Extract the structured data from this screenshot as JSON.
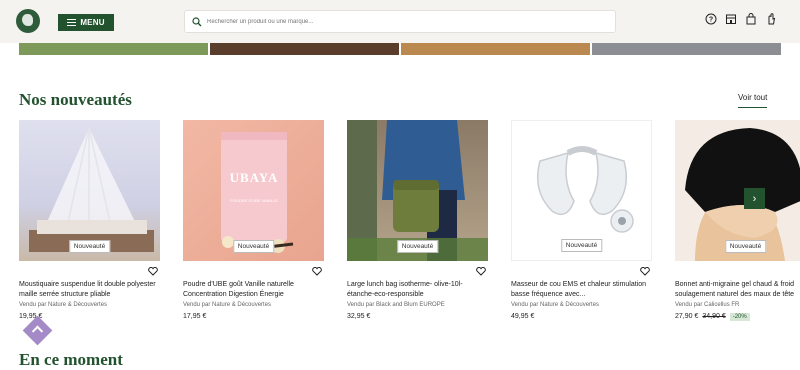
{
  "header": {
    "menu_label": "MENU",
    "search_placeholder": "Rechercher un produit ou une marque..."
  },
  "new_section": {
    "title": "Nos nouveautés",
    "see_all": "Voir tout"
  },
  "products": [
    {
      "title": "Moustiquaire suspendue lit double polyester maille serrée structure pliable",
      "seller": "Vendu par Nature & Découvertes",
      "price": "19,95 €",
      "badge": "Nouveauté"
    },
    {
      "title": "Poudre d'UBE goût Vanille naturelle Concentration Digestion Énergie",
      "seller": "Vendu par Nature & Découvertes",
      "price": "17,95 €",
      "badge": "Nouveauté",
      "image_text": "UBAYA",
      "image_subtext": "POUDRE D'UBE VANILLE"
    },
    {
      "title": "Large lunch bag isotherme- olive-10l-étanche-eco-responsible",
      "seller": "Vendu par Black and Blum EUROPE",
      "price": "32,95 €",
      "badge": "Nouveauté"
    },
    {
      "title": "Masseur de cou EMS et chaleur stimulation basse fréquence avec...",
      "seller": "Vendu par Nature & Découvertes",
      "price": "49,95 €",
      "badge": "Nouveauté"
    },
    {
      "title": "Bonnet anti-migraine gel chaud & froid soulagement naturel des maux de tête",
      "seller": "Vendu par Calicellus FR",
      "price": "27,90 €",
      "old_price": "34,90 €",
      "discount": "-20%",
      "badge": "Nouveauté"
    }
  ],
  "moment_section": {
    "title": "En ce moment"
  },
  "colors": {
    "brand_green": "#23522f",
    "accent_purple": "#a48ac6"
  }
}
